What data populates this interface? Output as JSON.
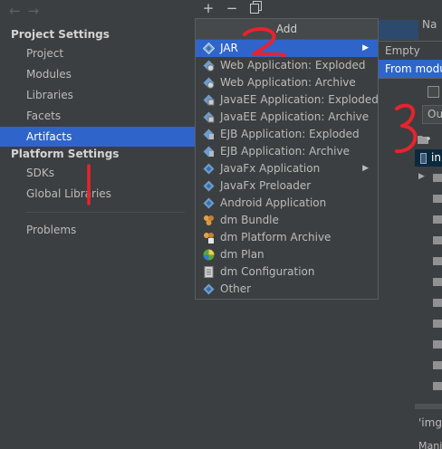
{
  "nav": {
    "back_icon": "back-arrow-icon",
    "forward_icon": "forward-arrow-icon"
  },
  "sidebar": {
    "project_settings_title": "Project Settings",
    "project_items": [
      {
        "label": "Project"
      },
      {
        "label": "Modules"
      },
      {
        "label": "Libraries"
      },
      {
        "label": "Facets"
      },
      {
        "label": "Artifacts",
        "selected": true
      }
    ],
    "platform_settings_title": "Platform Settings",
    "platform_items": [
      {
        "label": "SDKs"
      },
      {
        "label": "Global Libraries"
      }
    ],
    "problems_label": "Problems"
  },
  "toolbar": {
    "add_icon": "plus-icon",
    "remove_icon": "minus-icon",
    "copy_icon": "copy-icon"
  },
  "popup": {
    "title": "Add",
    "items": [
      {
        "label": "JAR",
        "icon": "artifact-diamond-icon",
        "submenu": true,
        "selected": true
      },
      {
        "label": "Web Application: Exploded",
        "icon": "web-app-icon"
      },
      {
        "label": "Web Application: Archive",
        "icon": "web-app-icon"
      },
      {
        "label": "JavaEE Application: Exploded",
        "icon": "javaee-app-icon"
      },
      {
        "label": "JavaEE Application: Archive",
        "icon": "javaee-app-icon"
      },
      {
        "label": "EJB Application: Exploded",
        "icon": "ejb-app-icon"
      },
      {
        "label": "EJB Application: Archive",
        "icon": "ejb-app-icon"
      },
      {
        "label": "JavaFx Application",
        "icon": "artifact-diamond-icon",
        "submenu": true
      },
      {
        "label": "JavaFx Preloader",
        "icon": "artifact-diamond-icon"
      },
      {
        "label": "Android Application",
        "icon": "artifact-diamond-icon"
      },
      {
        "label": "dm Bundle",
        "icon": "dm-bundle-icon"
      },
      {
        "label": "dm Platform Archive",
        "icon": "dm-platform-icon"
      },
      {
        "label": "dm Plan",
        "icon": "dm-plan-icon"
      },
      {
        "label": "dm Configuration",
        "icon": "dm-config-icon"
      },
      {
        "label": "Other",
        "icon": "artifact-diamond-icon"
      }
    ]
  },
  "submenu": {
    "items": [
      {
        "label": "Empty"
      },
      {
        "label": "From modu",
        "selected": true
      }
    ]
  },
  "right_partial": {
    "name_label": "Na",
    "output_field_value": "Ou",
    "tree_selected_label": "in",
    "bottom_text": "'img",
    "bottom_text_2": "Mani"
  },
  "annotations": {
    "one": "1",
    "two": "2",
    "three": "3",
    "color": "#e8232d"
  },
  "colors": {
    "selection": "#2f65ca",
    "background": "#3c3f41"
  }
}
